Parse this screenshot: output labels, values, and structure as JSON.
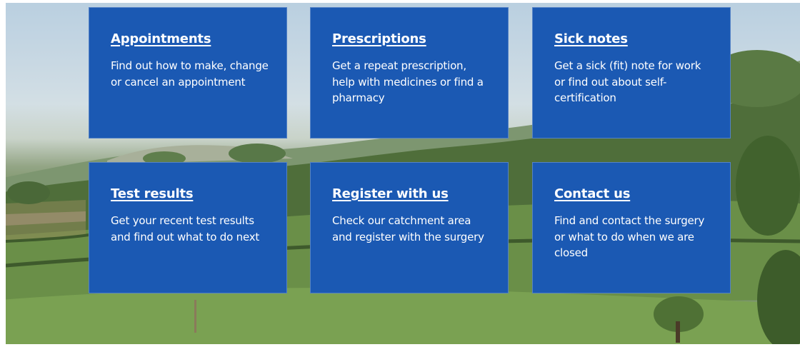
{
  "tiles": [
    {
      "title": "Appointments",
      "description": "Find out how to make, change or cancel an appointment"
    },
    {
      "title": "Prescriptions",
      "description": "Get a repeat prescription, help with medicines or find a pharmacy"
    },
    {
      "title": "Sick notes",
      "description": "Get a sick (fit) note for work or find out about self-certification"
    },
    {
      "title": "Test results",
      "description": "Get your recent test results and find out what to do next"
    },
    {
      "title": "Register with us",
      "description": "Check our catchment area and register with the surgery"
    },
    {
      "title": "Contact us",
      "description": "Find and contact the surgery or what to do when we are closed"
    }
  ],
  "colors": {
    "tile_background": "#1b59b3",
    "tile_text": "#ffffff"
  }
}
